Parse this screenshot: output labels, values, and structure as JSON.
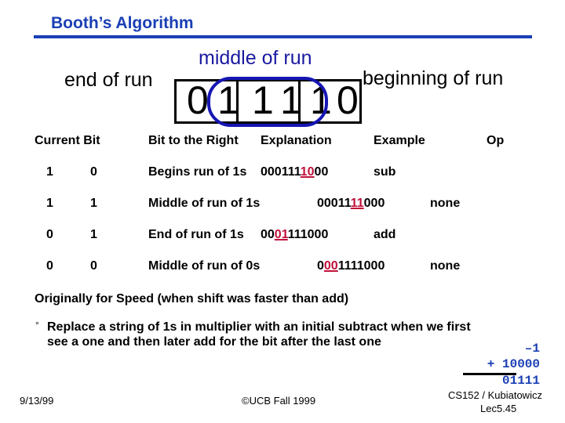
{
  "slide": {
    "title": "Booth’s Algorithm",
    "labels": {
      "end_of_run": "end of run",
      "middle_of_run": "middle of run",
      "beginning_of_run": "beginning of run"
    },
    "bits": [
      "0",
      "1",
      "1",
      "1",
      "1",
      "0"
    ],
    "table": {
      "headers": [
        "Current Bit",
        "Bit to the Right",
        "Explanation",
        "Example",
        "Op"
      ],
      "rows": [
        {
          "current": "1",
          "right": "0",
          "explanation": "Begins run of 1s",
          "example_pre": "000111",
          "example_hl": "10",
          "example_post": "00",
          "op": "sub"
        },
        {
          "current": "1",
          "right": "1",
          "explanation": "Middle of  run of 1s",
          "example_pre": "00011",
          "example_hl": "11",
          "example_post": "000",
          "op": "none"
        },
        {
          "current": "0",
          "right": "1",
          "explanation": "End of  run of 1s",
          "example_pre": "00",
          "example_hl": "01",
          "example_post": "111000",
          "op": "add"
        },
        {
          "current": "0",
          "right": "0",
          "explanation": "Middle of  run of 0s",
          "example_pre": "0",
          "example_hl": "00",
          "example_post": "1111000",
          "op": "none"
        }
      ]
    },
    "note_heading": "Originally for Speed (when shift was faster than add)",
    "bullet_symbol": "°",
    "bullet_line1": "Replace a string of 1s in multiplier with an initial subtract when we first",
    "bullet_line2": "see a one and then later add for the bit after the last one",
    "arith": {
      "line1": "–1",
      "line2": "+ 10000",
      "result": "01111"
    },
    "footer": {
      "date": "9/13/99",
      "copyright": "©UCB Fall 1999",
      "course": "CS152 / Kubiatowicz",
      "lecture": "Lec5.45"
    },
    "colors": {
      "title_blue": "#1a3fb5",
      "oval_blue": "#1616b4",
      "highlight_red": "#c0103a"
    }
  }
}
